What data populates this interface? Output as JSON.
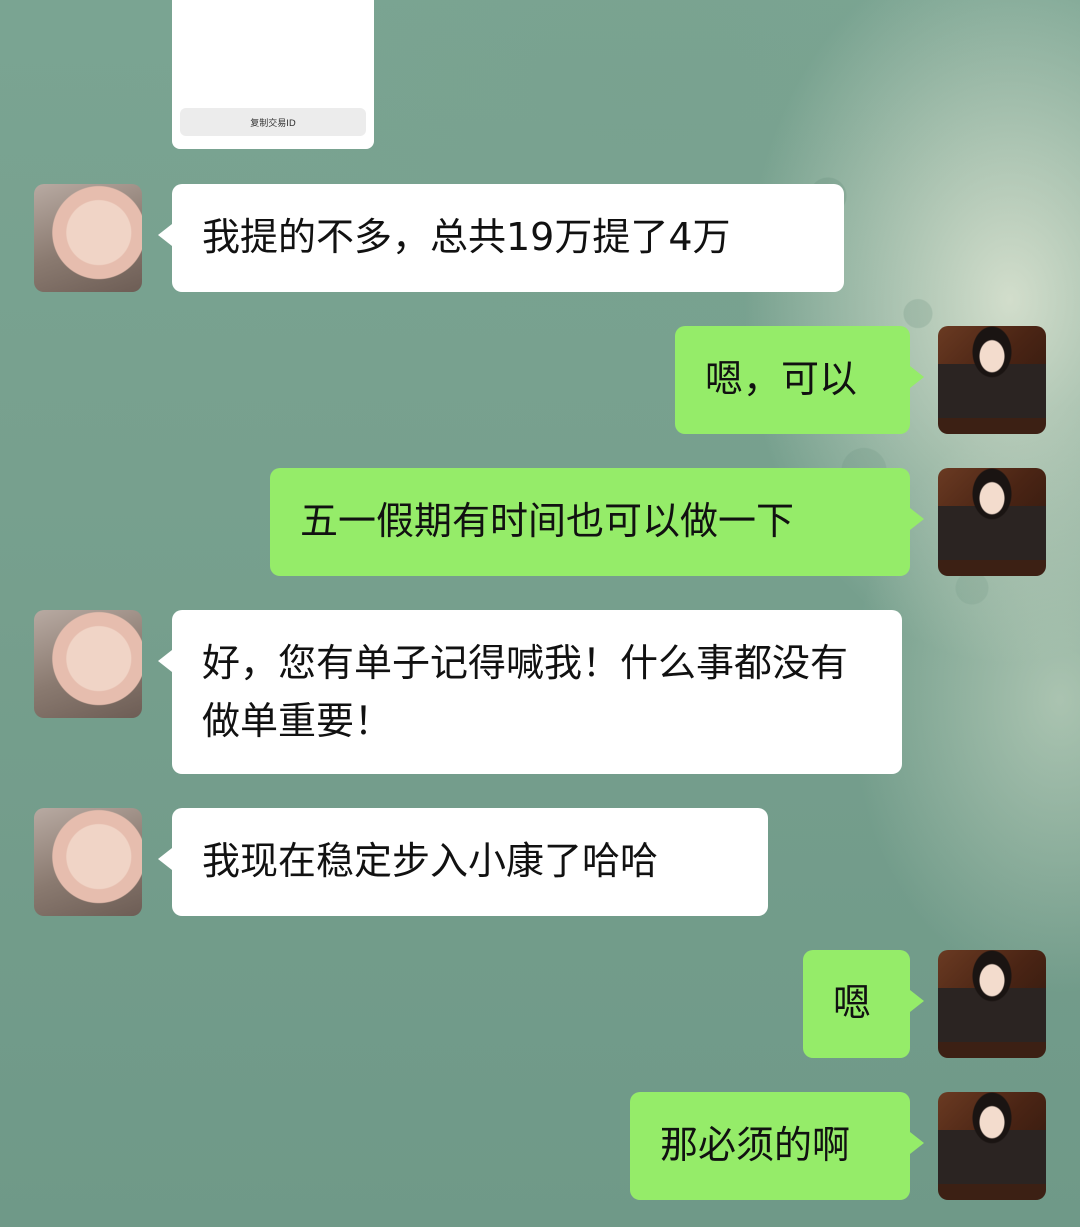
{
  "transaction_card": {
    "copy_button_label": "复制交易ID"
  },
  "messages": [
    {
      "side": "left",
      "avatar": "pig-avatar",
      "text": "我提的不多，总共19万提了4万"
    },
    {
      "side": "right",
      "avatar": "woman-avatar",
      "text": "嗯，可以"
    },
    {
      "side": "right",
      "avatar": "woman-avatar",
      "text": "五一假期有时间也可以做一下"
    },
    {
      "side": "left",
      "avatar": "pig-avatar",
      "text": "好，您有单子记得喊我！什么事都没有做单重要！"
    },
    {
      "side": "left",
      "avatar": "pig-avatar",
      "text": "我现在稳定步入小康了哈哈"
    },
    {
      "side": "right",
      "avatar": "woman-avatar",
      "text": "嗯"
    },
    {
      "side": "right",
      "avatar": "woman-avatar",
      "text": "那必须的啊"
    }
  ],
  "colors": {
    "received_bubble": "#ffffff",
    "sent_bubble": "#95ec69",
    "background": "#76a08e"
  }
}
